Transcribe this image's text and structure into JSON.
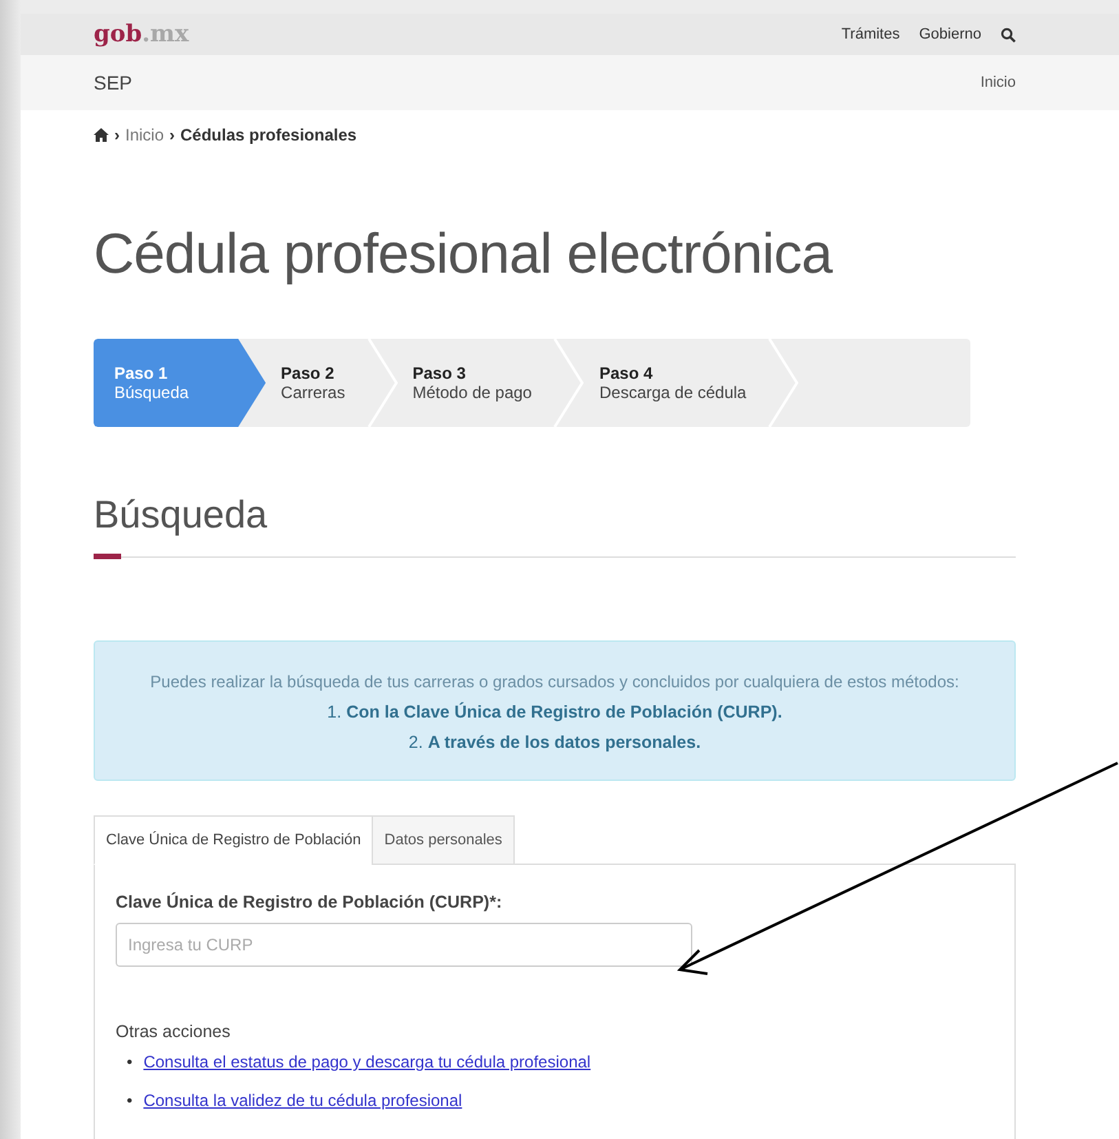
{
  "header": {
    "logo_main": "gob",
    "logo_suffix": ".mx",
    "nav": [
      "Trámites",
      "Gobierno"
    ]
  },
  "subheader": {
    "title": "SEP",
    "link": "Inicio"
  },
  "breadcrumb": [
    {
      "separator": "›",
      "label": "Inicio",
      "current": false
    },
    {
      "separator": "›",
      "label": "Cédulas profesionales",
      "current": true
    }
  ],
  "page_title": "Cédula profesional electrónica",
  "steps": [
    {
      "label": "Paso 1",
      "detail": "Búsqueda",
      "selected": true
    },
    {
      "label": "Paso 2",
      "detail": "Carreras",
      "selected": false
    },
    {
      "label": "Paso 3",
      "detail": "Método de pago",
      "selected": false
    },
    {
      "label": "Paso 4",
      "detail": "Descarga de cédula",
      "selected": false
    }
  ],
  "section_title": "Búsqueda",
  "info": {
    "intro": "Puedes realizar la búsqueda de tus carreras o grados cursados y concluidos por cualquiera de estos métodos:",
    "methods": [
      "1. **Con la Clave Única de Registro de Población (CURP).**",
      "2. **A través de los datos personales.**"
    ]
  },
  "tabs": [
    {
      "label": "Clave Única de Registro de Población",
      "selected": true
    },
    {
      "label": "Datos personales",
      "selected": false
    }
  ],
  "form": {
    "label": "Clave Única de Registro de Población (CURP)*:",
    "placeholder": "Ingresa tu CURP"
  },
  "other_actions": {
    "title": "Otras acciones",
    "bullet": "•",
    "links": [
      "Consulta el estatus de pago y descarga tu cédula profesional",
      "Consulta la validez de tu cédula profesional"
    ]
  }
}
